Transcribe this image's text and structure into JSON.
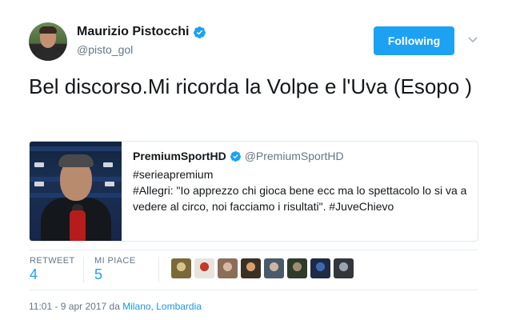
{
  "author": {
    "display_name": "Maurizio Pistocchi",
    "handle": "@pisto_gol",
    "verified_icon": "verified-badge-icon"
  },
  "follow_button": {
    "label": "Following"
  },
  "tweet": {
    "text": "Bel discorso.Mi ricorda la Volpe e l'Uva (Esopo )"
  },
  "quoted_tweet": {
    "display_name": "PremiumSportHD",
    "handle": "@PremiumSportHD",
    "line1": "#serieapremium",
    "line2": "#Allegri: \"Io apprezzo chi gioca bene ecc ma lo spettacolo lo si va a vedere al circo, noi facciamo i risultati\". #JuveChievo"
  },
  "stats": {
    "retweet_label": "RETWEET",
    "retweet_count": "4",
    "likes_label": "MI PIACE",
    "likes_count": "5"
  },
  "likers": [
    {
      "colors": [
        "#7a6a3a",
        "#d8c48a"
      ]
    },
    {
      "colors": [
        "#e8e4dc",
        "#c0392b"
      ]
    },
    {
      "colors": [
        "#8a6e5a",
        "#d9b8a0"
      ]
    },
    {
      "colors": [
        "#3b3024",
        "#d8a070"
      ]
    },
    {
      "colors": [
        "#4a5a6a",
        "#c9b5a0"
      ]
    },
    {
      "colors": [
        "#2e3c2a",
        "#a08c70"
      ]
    },
    {
      "colors": [
        "#1f2a44",
        "#3c6ab0"
      ]
    },
    {
      "colors": [
        "#33363c",
        "#9aa3b0"
      ]
    }
  ],
  "meta": {
    "time": "11:01 - 9 apr 2017 da ",
    "location": "Milano, Lombardia"
  },
  "colors": {
    "accent": "#1da1f2",
    "secondary_text": "#657786"
  }
}
